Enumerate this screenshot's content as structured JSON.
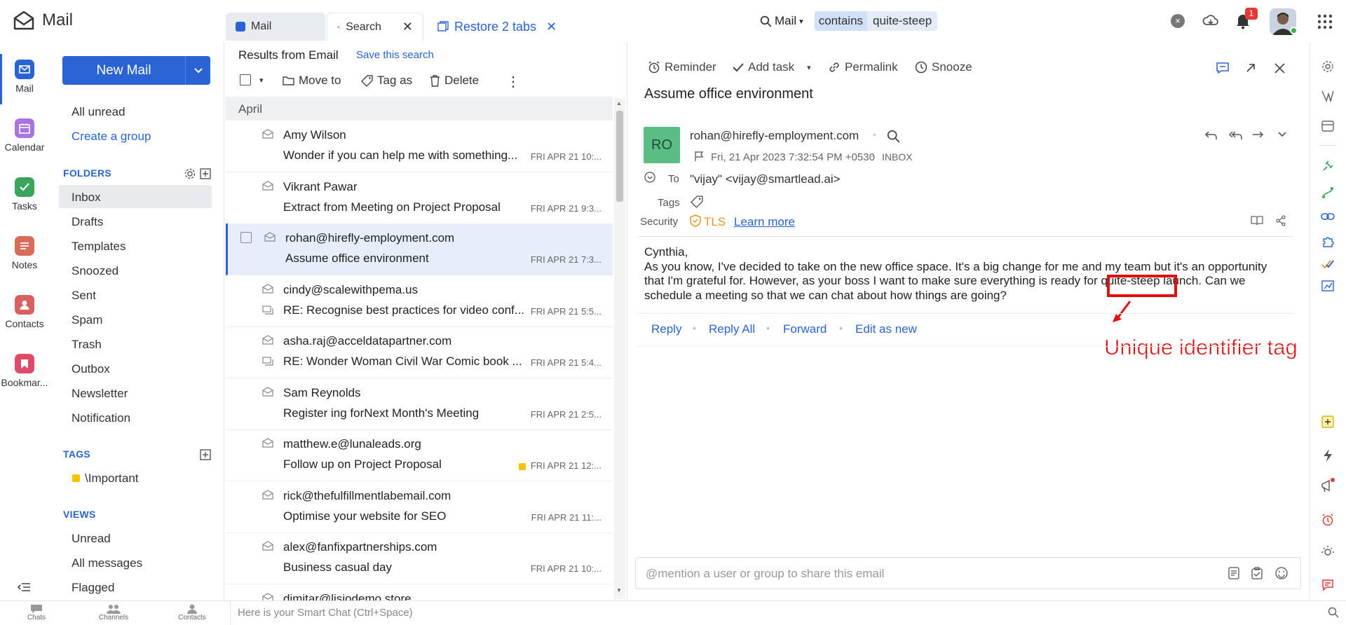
{
  "app": {
    "title": "Mail"
  },
  "tabs": [
    {
      "label": "Mail"
    },
    {
      "label": "Search"
    },
    {
      "label": "Restore 2 tabs"
    }
  ],
  "search": {
    "scope": "Mail",
    "operator": "contains",
    "query": "quite-steep",
    "clear": "×"
  },
  "notifications": {
    "count": "1"
  },
  "rail": [
    {
      "label": "Mail",
      "color": "#2a63d3"
    },
    {
      "label": "Calendar",
      "color": "#a774e0"
    },
    {
      "label": "Tasks",
      "color": "#3aa55b"
    },
    {
      "label": "Notes",
      "color": "#d86b5a"
    },
    {
      "label": "Contacts",
      "color": "#d8615e"
    },
    {
      "label": "Bookmar...",
      "color": "#e04a6a"
    }
  ],
  "folders": {
    "new_mail": "New Mail",
    "all_unread": "All unread",
    "create_group": "Create a group",
    "folders_title": "FOLDERS",
    "items": [
      "Inbox",
      "Drafts",
      "Templates",
      "Snoozed",
      "Sent",
      "Spam",
      "Trash",
      "Outbox",
      "Newsletter",
      "Notification"
    ],
    "tags_title": "TAGS",
    "tags": [
      "\\Important"
    ],
    "views_title": "VIEWS",
    "views": [
      "Unread",
      "All messages",
      "Flagged"
    ]
  },
  "list": {
    "title": "Results from Email",
    "save_search": "Save this search",
    "move_to": "Move to",
    "tag_as": "Tag as",
    "delete": "Delete",
    "month": "April",
    "rows": [
      {
        "from": "Amy Wilson",
        "subject": "Wonder if you can help me with something...",
        "date": "FRI APR 21 10:..."
      },
      {
        "from": "Vikrant Pawar",
        "subject": "Extract from Meeting on Project Proposal",
        "date": "FRI APR 21 9:3..."
      },
      {
        "from": "rohan@hirefly-employment.com",
        "subject": "Assume office environment",
        "date": "FRI APR 21 7:3..."
      },
      {
        "from": "cindy@scalewithpema.us",
        "subject": "RE: Recognise best practices for video conf...",
        "date": "FRI APR 21 5:5..."
      },
      {
        "from": "asha.raj@acceldatapartner.com",
        "subject": "RE: Wonder Woman Civil War Comic book ...",
        "date": "FRI APR 21 5:4..."
      },
      {
        "from": "Sam Reynolds",
        "subject": "Register ing forNext Month's Meeting",
        "date": "FRI APR 21 2:5..."
      },
      {
        "from": "matthew.e@lunaleads.org",
        "subject": "Follow up on Project Proposal",
        "date": "FRI APR 21 12:..."
      },
      {
        "from": "rick@thefulfillmentlabemail.com",
        "subject": "Optimise your website for SEO",
        "date": "FRI APR 21 11:..."
      },
      {
        "from": "alex@fanfixpartnerships.com",
        "subject": "Business casual day",
        "date": "FRI APR 21 10:..."
      },
      {
        "from": "dimitar@lisiodemo.store",
        "subject": "",
        "date": ""
      }
    ]
  },
  "reader": {
    "reminder": "Reminder",
    "add_task": "Add task",
    "permalink": "Permalink",
    "snooze": "Snooze",
    "subject": "Assume office environment",
    "avatar": "RO",
    "sender": "rohan@hirefly-employment.com",
    "date": "Fri, 21 Apr 2023 7:32:54 PM +0530",
    "folder": "INBOX",
    "to_label": "To",
    "to_value": "\"vijay\" <vijay@smartlead.ai>",
    "tags_label": "Tags",
    "security_label": "Security",
    "tls": "TLS",
    "learn_more": "Learn more",
    "body_greeting": "Cynthia,",
    "body_line1_pre": "As you know, I've decided to take on the new office space. It's a big change for me and my team but it's an opportunity",
    "body_line2_pre": "that I'm grateful for. However, as your boss I want to make sure everything is ready for ",
    "body_highlight": "quite-steep",
    "body_line2_post": " launch. Can we",
    "body_line3": "schedule a meeting so that we can chat about how things are going?",
    "reply": "Reply",
    "reply_all": "Reply All",
    "forward": "Forward",
    "edit_as_new": "Edit as new",
    "annotation": "Unique identifier tag",
    "mention_placeholder": "@mention a user or group to share this email"
  },
  "bottom": {
    "chats": "Chats",
    "channels": "Channels",
    "contacts": "Contacts",
    "smart_chat": "Here is your Smart Chat (Ctrl+Space)"
  }
}
